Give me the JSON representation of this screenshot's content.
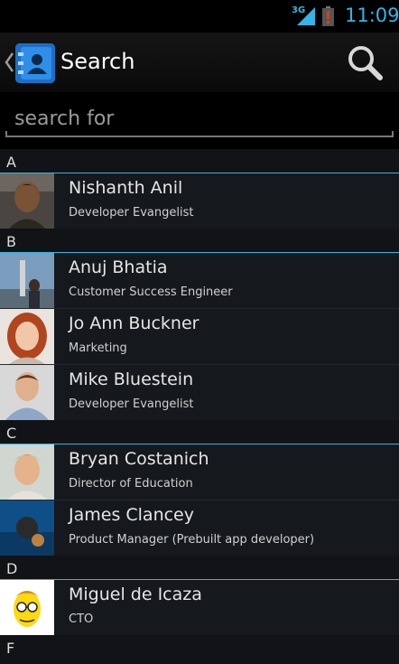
{
  "status_bar": {
    "network": "3G",
    "time": "11:09",
    "accent": "#33b5e5",
    "battery_alert_color": "#cc2200"
  },
  "action_bar": {
    "title": "Search",
    "app_icon": "contacts-book-icon",
    "search_icon": "search-icon"
  },
  "search": {
    "placeholder": "search for",
    "value": ""
  },
  "sections": [
    {
      "letter": "A",
      "contacts": [
        {
          "name": "Nishanth Anil",
          "title": "Developer Evangelist"
        }
      ]
    },
    {
      "letter": "B",
      "contacts": [
        {
          "name": "Anuj Bhatia",
          "title": "Customer Success Engineer"
        },
        {
          "name": "Jo Ann Buckner",
          "title": "Marketing"
        },
        {
          "name": "Mike Bluestein",
          "title": "Developer Evangelist"
        }
      ]
    },
    {
      "letter": "C",
      "contacts": [
        {
          "name": "Bryan Costanich",
          "title": "Director of Education"
        },
        {
          "name": "James Clancey",
          "title": "Product Manager (Prebuilt app developer)"
        }
      ]
    },
    {
      "letter": "D",
      "contacts": [
        {
          "name": "Miguel de Icaza",
          "title": "CTO"
        }
      ]
    },
    {
      "letter": "F",
      "contacts": []
    }
  ]
}
